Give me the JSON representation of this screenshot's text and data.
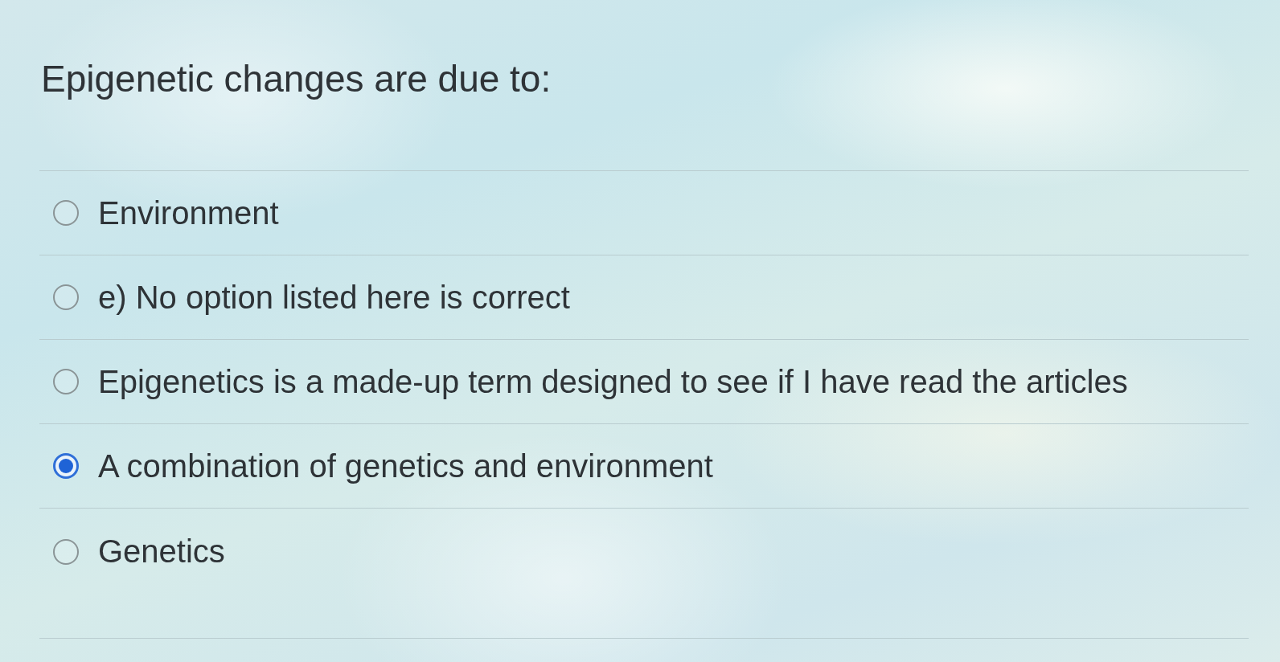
{
  "question": {
    "text": "Epigenetic changes are due to:"
  },
  "options": [
    {
      "label": "Environment",
      "selected": false
    },
    {
      "label": "e) No option listed here is correct",
      "selected": false
    },
    {
      "label": "Epigenetics is a made-up term designed to see if I have read the articles",
      "selected": false
    },
    {
      "label": "A combination of genetics and environment",
      "selected": true
    },
    {
      "label": "Genetics",
      "selected": false
    }
  ]
}
